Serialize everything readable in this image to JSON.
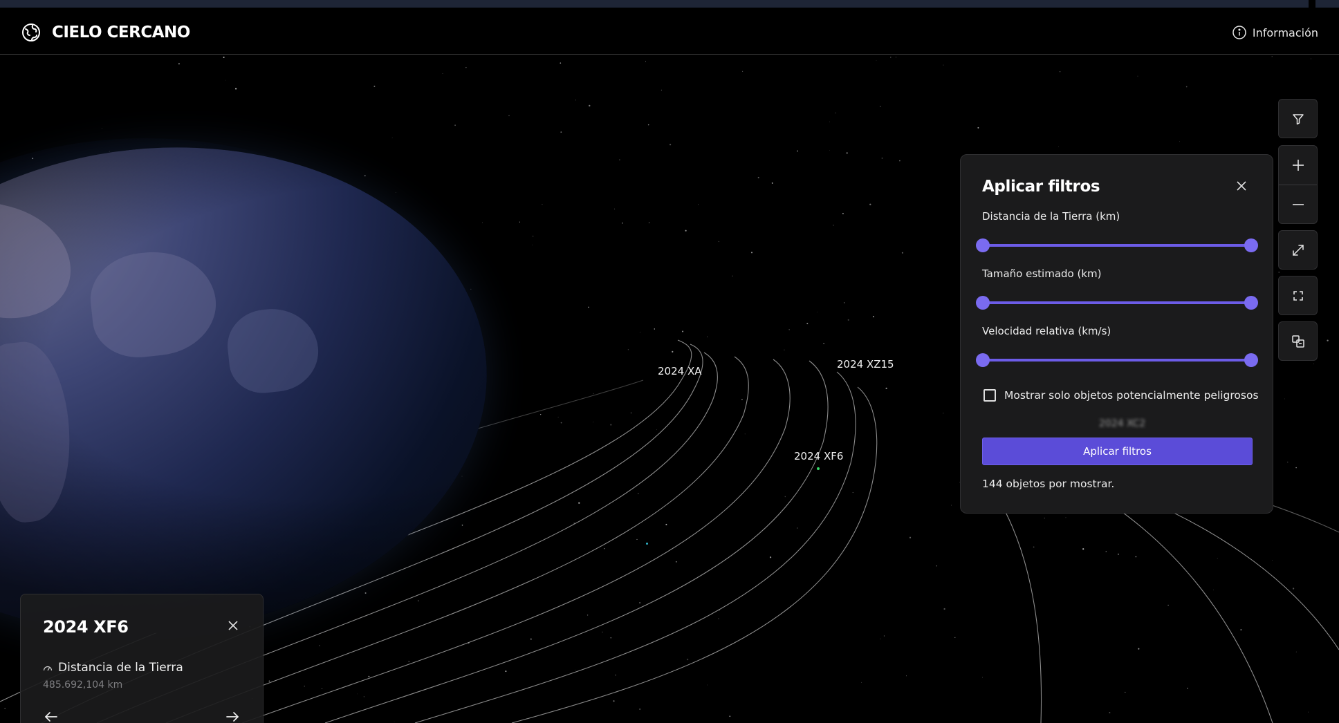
{
  "app": {
    "name": "CIELO CERCANO",
    "info_label": "Información"
  },
  "scene": {
    "orbit_labels": [
      "2024 XA",
      "2024 XZ15",
      "2024 XF6"
    ]
  },
  "filters": {
    "title": "Aplicar filtros",
    "sliders": [
      {
        "label": "Distancia de la Tierra (km)",
        "min_pos": 0,
        "max_pos": 1
      },
      {
        "label": "Tamaño estimado (km)",
        "min_pos": 0,
        "max_pos": 1
      },
      {
        "label": "Velocidad relativa (km/s)",
        "min_pos": 0,
        "max_pos": 1
      }
    ],
    "checkbox_label": "Mostrar solo objetos potencialmente peligrosos",
    "checkbox_checked": false,
    "blurred_label": "2024 XC2",
    "apply_label": "Aplicar filtros",
    "count_text": "144 objetos por mostrar."
  },
  "toolbar": {
    "icons": [
      "filter-icon",
      "zoom-in-icon",
      "zoom-out-icon",
      "expand-icon",
      "fullscreen-icon",
      "switch-view-icon"
    ]
  },
  "selected": {
    "name": "2024 XF6",
    "metric_label": "Distancia de la Tierra",
    "metric_value": "485.692,104 km"
  },
  "colors": {
    "accent": "#5b4cd8",
    "slider": "#6c5ce7",
    "panel": "#1b1b1c",
    "highlight_dot": "#37d86a"
  }
}
